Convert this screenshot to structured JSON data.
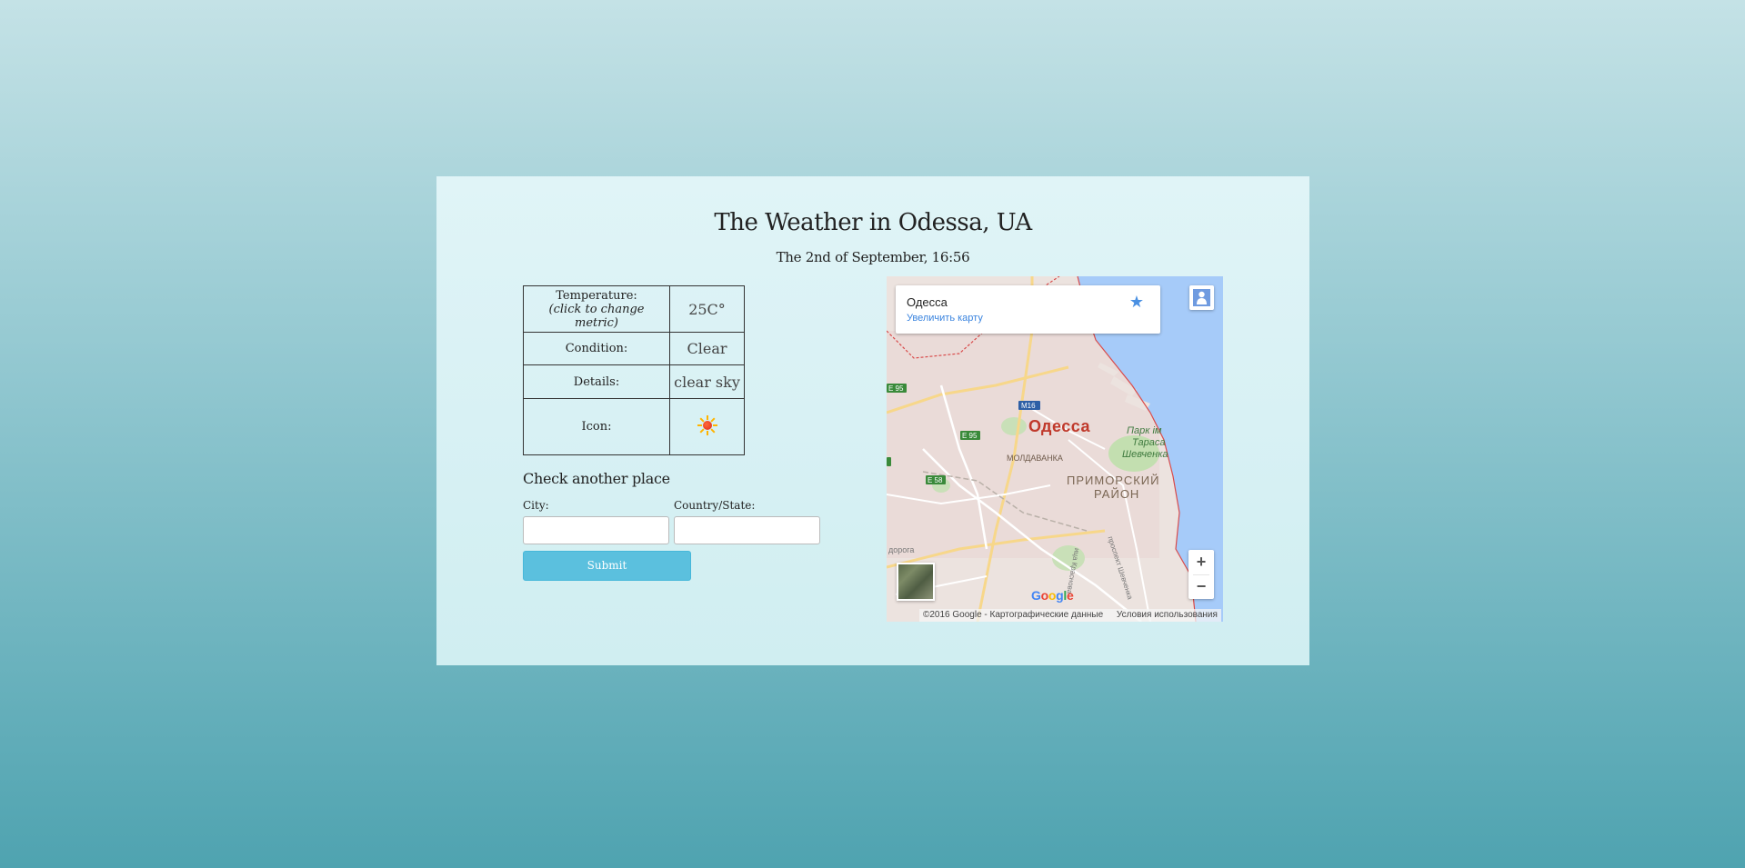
{
  "header": {
    "title": "The Weather in Odessa, UA",
    "datetime": "The 2nd of September, 16:56"
  },
  "weather": {
    "temperature_label": "Temperature:",
    "temperature_hint": "(click to change metric)",
    "temperature_value": "25C°",
    "condition_label": "Condition:",
    "condition_value": "Clear",
    "details_label": "Details:",
    "details_value": "clear sky",
    "icon_label": "Icon:",
    "icon_name": "sun-icon"
  },
  "form": {
    "heading": "Check another place",
    "city_label": "City:",
    "city_value": "",
    "country_label": "Country/State:",
    "country_value": "",
    "submit_label": "Submit",
    "submit_color": "#5bc0de"
  },
  "map": {
    "place_name": "Одесса",
    "enlarge_link": "Увеличить карту",
    "city_label": "Одесса",
    "district_label": "ПРИМОРСКИЙ",
    "district_label2": "РАЙОН",
    "park_label": "Парк ім",
    "park_label2": "Тараса",
    "park_label3": "Шевченка",
    "moldavanka_label": "МОЛДАВАНКА",
    "road_badges": [
      "E 95",
      "E 95",
      "M16",
      "E 58"
    ],
    "street_label": "проспект Шевченка",
    "street2_label": "ица Краснова",
    "road_label": "дорога",
    "attribution": "©2016 Google - Картографические данные",
    "terms": "Условия использования",
    "zoom_in": "+",
    "zoom_out": "−",
    "google_logo": [
      "G",
      "o",
      "o",
      "g",
      "l",
      "e"
    ]
  }
}
